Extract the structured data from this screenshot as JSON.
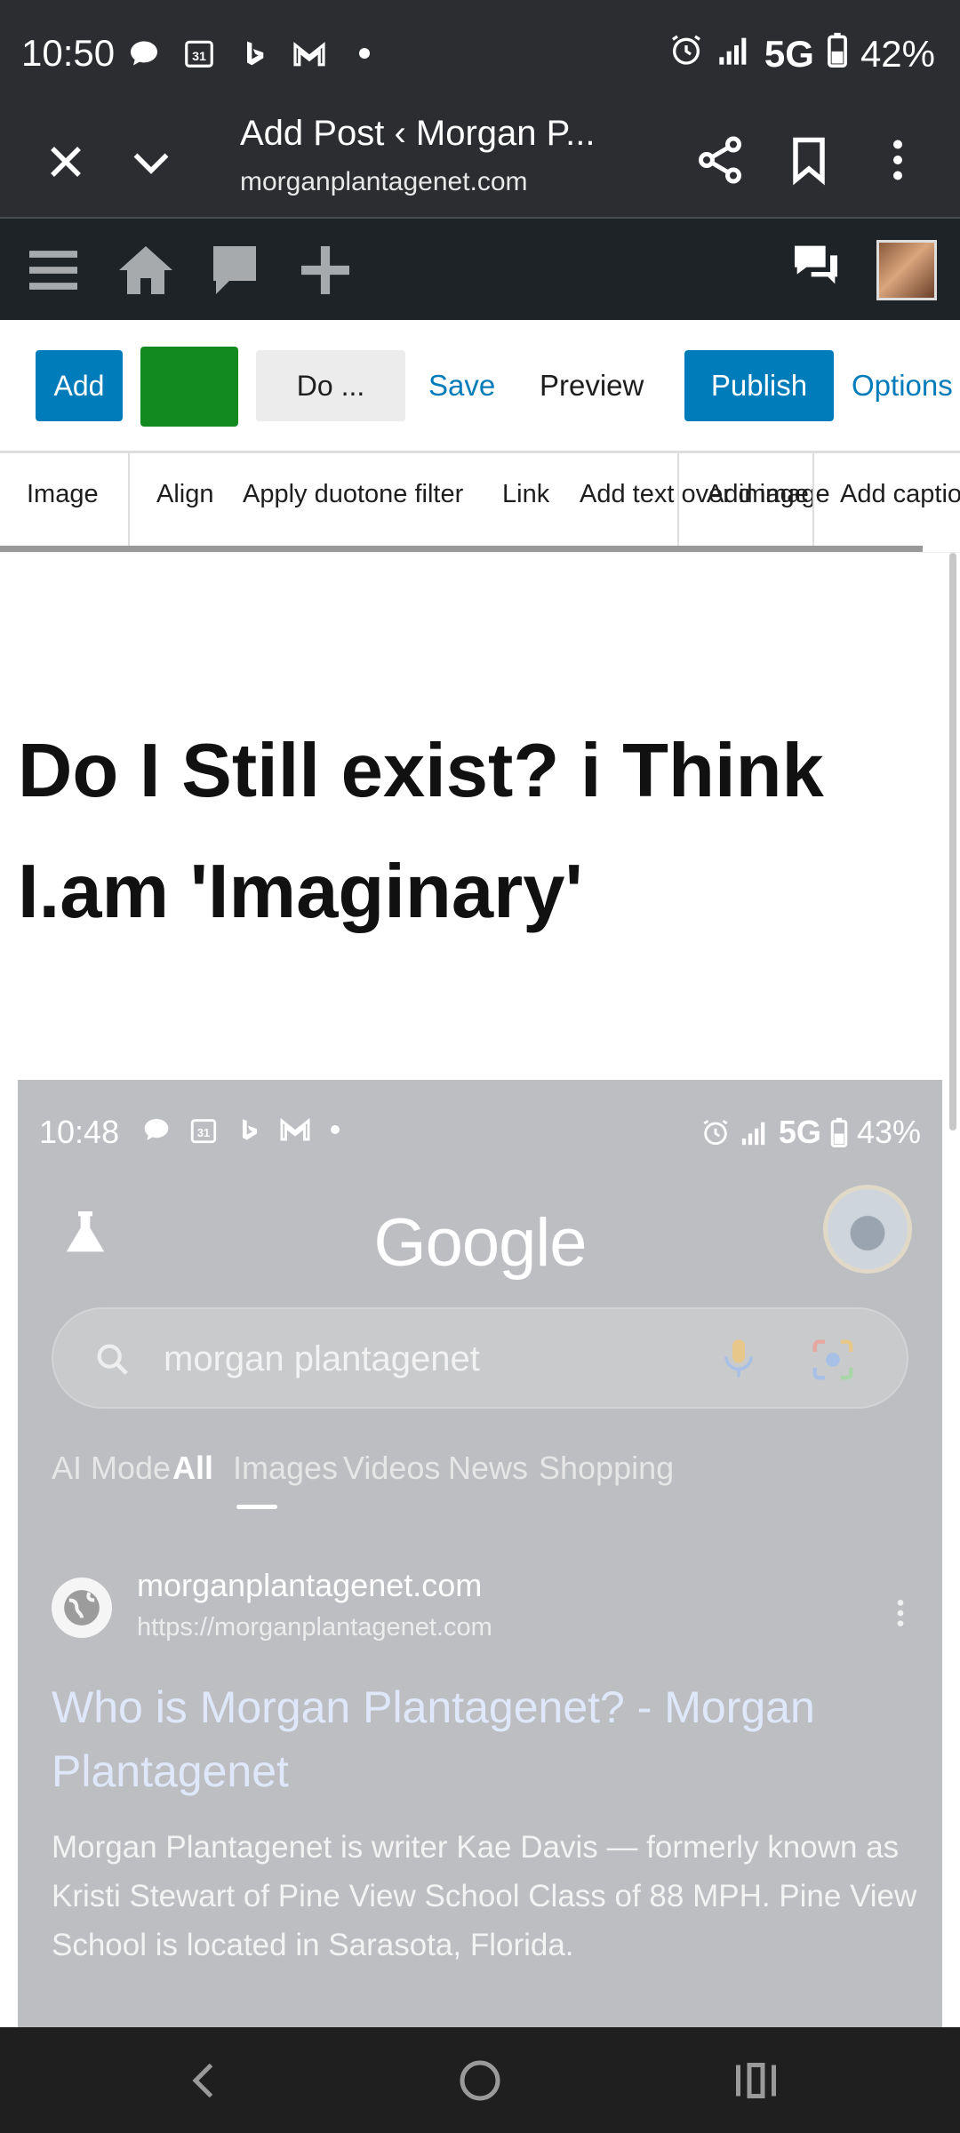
{
  "status_bar": {
    "time": "10:50",
    "network": "5G",
    "battery": "42%",
    "left_icons": [
      "chat-bubble-icon",
      "calendar-31-icon",
      "bing-icon",
      "gmail-icon",
      "dot-icon"
    ],
    "right_icons": [
      "alarm-icon",
      "signal-icon",
      "battery-icon"
    ]
  },
  "browser": {
    "title": "Add Post ‹ Morgan P...",
    "url": "morganplantagenet.com"
  },
  "admin_bar": {
    "icons": [
      "menu-icon",
      "home-icon",
      "comments-icon",
      "new-post-icon",
      "notifications-icon",
      "avatar"
    ]
  },
  "editor_toolbar": {
    "add_label": "Add",
    "doc_label": "Do ...",
    "save_label": "Save",
    "preview_label": "Preview",
    "publish_label": "Publish",
    "options_label": "Options",
    "green_block_color": "#138a1f",
    "accent_color": "#007cba"
  },
  "block_toolbar": {
    "image": "Image",
    "align": "Align",
    "duotone": "Apply duotone filter",
    "link": "Link",
    "text_over": "Add text over image",
    "add_image": "Add image",
    "add_caption": "Add caption"
  },
  "post": {
    "title": "Do I Still exist? i Think I.am 'Imaginary'"
  },
  "embedded_screenshot": {
    "time": "10:48",
    "network": "5G",
    "battery": "43%",
    "logo": "Google",
    "search_query": "morgan plantagenet",
    "tabs": [
      "AI Mode",
      "All",
      "Images",
      "Videos",
      "News",
      "Shopping"
    ],
    "active_tab": "All",
    "site_name": "morganplantagenet.com",
    "site_url": "https://morganplantagenet.com",
    "result_title": "Who is Morgan Plantagenet? - Morgan Plantagenet",
    "snippet": "Morgan Plantagenet is writer Kae Davis — formerly known as Kristi Stewart of Pine View School Class of 88 MPH. Pine View School is located in Sarasota, Florida."
  },
  "nav_bar": {
    "icons": [
      "back-icon",
      "home-circle-icon",
      "recents-icon"
    ]
  }
}
